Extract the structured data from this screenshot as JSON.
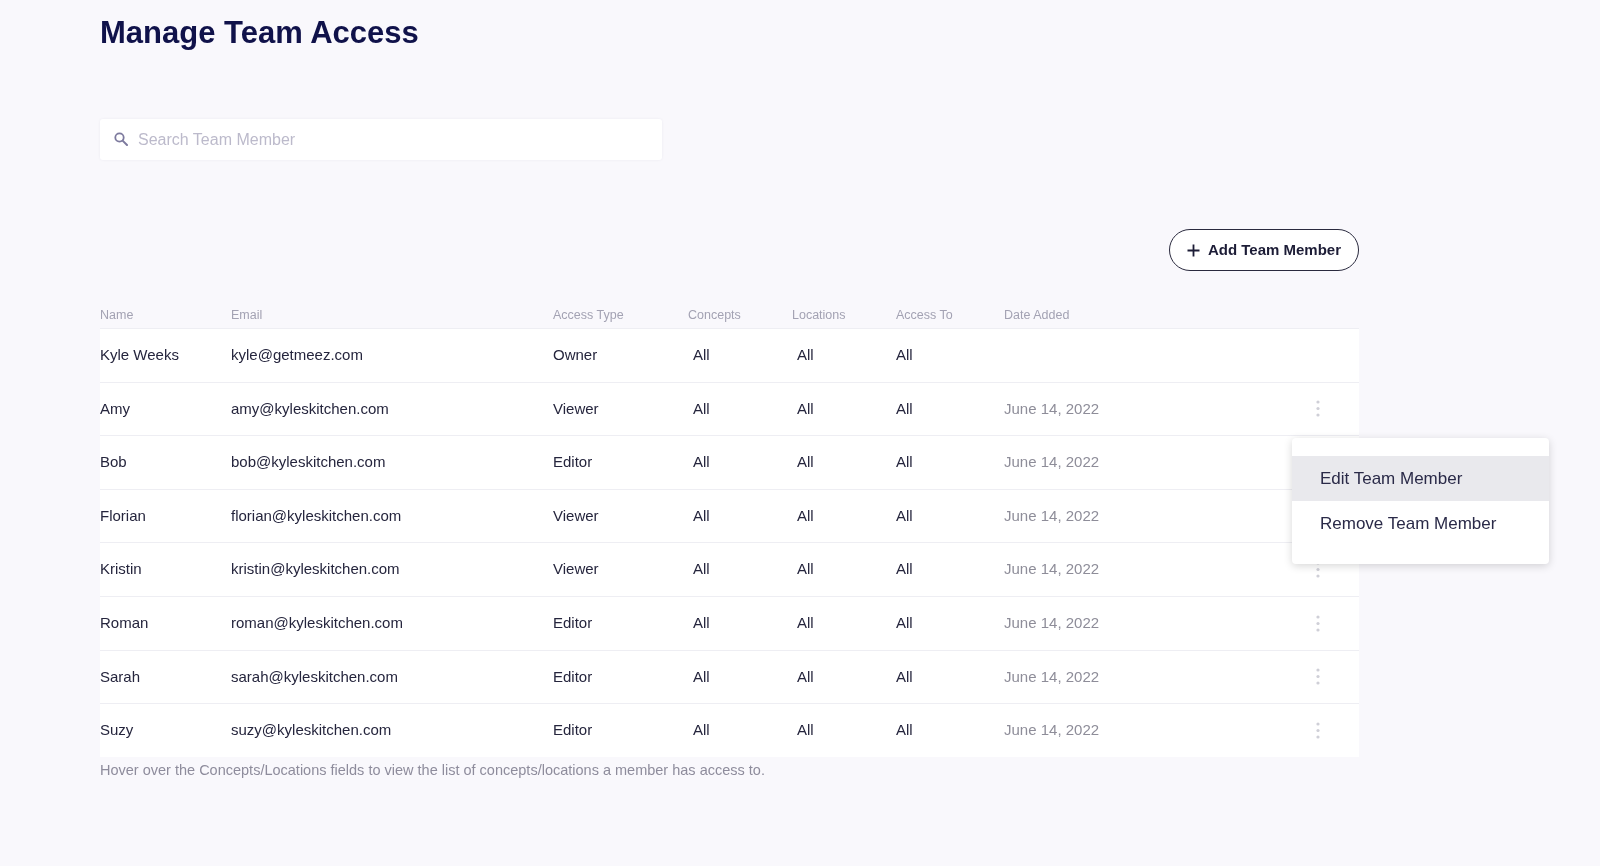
{
  "title": "Manage Team Access",
  "search": {
    "placeholder": "Search Team Member"
  },
  "add_button": {
    "label": "Add Team Member"
  },
  "table": {
    "columns": [
      "Name",
      "Email",
      "Access Type",
      "Concepts",
      "Locations",
      "Access To",
      "Date Added"
    ],
    "rows": [
      {
        "name": "Kyle Weeks",
        "email": "kyle@getmeez.com",
        "access_type": "Owner",
        "concepts": "All",
        "locations": "All",
        "access_to": "All",
        "actions": false
      },
      {
        "name": "Amy",
        "email": "amy@kyleskitchen.com",
        "access_type": "Viewer",
        "concepts": "All",
        "locations": "All",
        "access_to": "All",
        "date_added": "June 14, 2022",
        "actions": true
      },
      {
        "name": "Bob",
        "email": "bob@kyleskitchen.com",
        "access_type": "Editor",
        "concepts": "All",
        "locations": "All",
        "access_to": "All",
        "date_added": "June 14, 2022",
        "actions": false
      },
      {
        "name": "Florian",
        "email": "florian@kyleskitchen.com",
        "access_type": "Viewer",
        "concepts": "All",
        "locations": "All",
        "access_to": "All",
        "date_added": "June 14, 2022",
        "actions": false
      },
      {
        "name": "Kristin",
        "email": "kristin@kyleskitchen.com",
        "access_type": "Viewer",
        "concepts": "All",
        "locations": "All",
        "access_to": "All",
        "date_added": "June 14, 2022",
        "actions": true
      },
      {
        "name": "Roman",
        "email": "roman@kyleskitchen.com",
        "access_type": "Editor",
        "concepts": "All",
        "locations": "All",
        "access_to": "All",
        "date_added": "June 14, 2022",
        "actions": true
      },
      {
        "name": "Sarah",
        "email": "sarah@kyleskitchen.com",
        "access_type": "Editor",
        "concepts": "All",
        "locations": "All",
        "access_to": "All",
        "date_added": "June 14, 2022",
        "actions": true
      },
      {
        "name": "Suzy",
        "email": "suzy@kyleskitchen.com",
        "access_type": "Editor",
        "concepts": "All",
        "locations": "All",
        "access_to": "All",
        "date_added": "June 14, 2022",
        "actions": true
      }
    ]
  },
  "context_menu": {
    "items": [
      {
        "label": "Edit Team Member",
        "selected": true
      },
      {
        "label": "Remove Team Member",
        "selected": false
      }
    ]
  },
  "footnote": "Hover over the Concepts/Locations fields to view the list of concepts/locations a member has access to."
}
